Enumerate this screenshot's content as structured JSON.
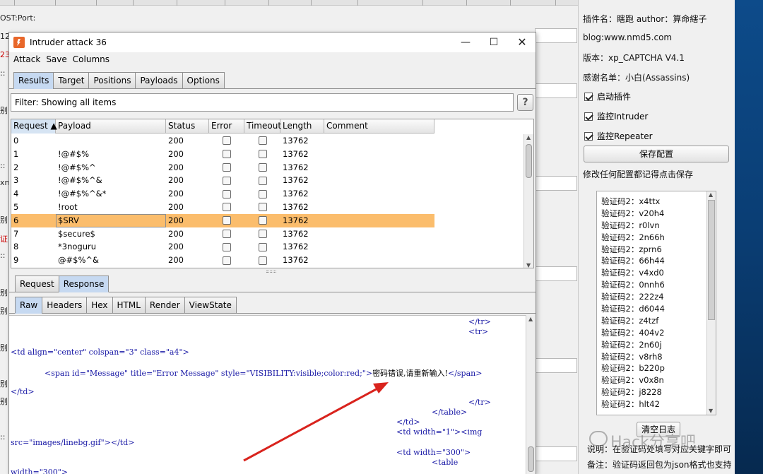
{
  "background_app": {
    "labels": [
      "OST:Port:",
      "12",
      "23",
      "::",
      "别",
      "::",
      "xn",
      "别",
      "证",
      "::",
      "别",
      "别",
      "别",
      "别",
      "别",
      "::"
    ]
  },
  "plugin_panel": {
    "plugin_name": "插件名：瞎跑 author：算命縖子",
    "blog": "blog:www.nmd5.com",
    "version": "版本：xp_CAPTCHA V4.1",
    "thanks": "感谢名单：小白(Assassins)",
    "checkboxes": [
      {
        "label": "启动插件",
        "checked": true
      },
      {
        "label": "监控Intruder",
        "checked": true
      },
      {
        "label": "监控Repeater",
        "checked": true
      }
    ],
    "save_button": "保存配置",
    "save_hint": "修改任何配置都记得点击保存",
    "captcha_log": [
      "验证码2：x4ttx",
      "验证码2：v20h4",
      "验证码2：r0lvn",
      "验证码2：2n66h",
      "验证码2：zprn6",
      "验证码2：66h44",
      "验证码2：v4xd0",
      "验证码2：0nnh6",
      "验证码2：222z4",
      "验证码2：d6044",
      "验证码2：z4tzf",
      "验证码2：404v2",
      "验证码2：2n60j",
      "验证码2：v8rh8",
      "验证码2：b220p",
      "验证码2：v0x8n",
      "验证码2：j8228",
      "验证码2：hlt42"
    ],
    "clear_button": "清空日志",
    "note1": "说明：在验证码处填写对应关键字即可",
    "note2": "备注：验证码返回包为json格式也支持"
  },
  "watermark": "Hack分享吧",
  "window": {
    "title": "Intruder attack 36",
    "menu": [
      "Attack",
      "Save",
      "Columns"
    ],
    "tabs": [
      "Results",
      "Target",
      "Positions",
      "Payloads",
      "Options"
    ],
    "active_tab": "Results",
    "filter": "Filter: Showing all items",
    "help": "?",
    "columns": [
      "Request ▲",
      "Payload",
      "Status",
      "Error",
      "Timeout",
      "Length",
      "Comment"
    ],
    "rows": [
      {
        "request": "0",
        "payload": "",
        "status": "200",
        "length": "13762"
      },
      {
        "request": "1",
        "payload": "!@#$%",
        "status": "200",
        "length": "13762"
      },
      {
        "request": "2",
        "payload": "!@#$%^",
        "status": "200",
        "length": "13762"
      },
      {
        "request": "3",
        "payload": "!@#$%^&",
        "status": "200",
        "length": "13762"
      },
      {
        "request": "4",
        "payload": "!@#$%^&*",
        "status": "200",
        "length": "13762"
      },
      {
        "request": "5",
        "payload": "!root",
        "status": "200",
        "length": "13762"
      },
      {
        "request": "6",
        "payload": "$SRV",
        "status": "200",
        "length": "13762",
        "selected": true
      },
      {
        "request": "7",
        "payload": "$secure$",
        "status": "200",
        "length": "13762"
      },
      {
        "request": "8",
        "payload": "*3noguru",
        "status": "200",
        "length": "13762"
      },
      {
        "request": "9",
        "payload": "@#$%^&",
        "status": "200",
        "length": "13762"
      }
    ],
    "reqresp_tabs": [
      "Request",
      "Response"
    ],
    "active_reqresp": "Response",
    "view_tabs": [
      "Raw",
      "Headers",
      "Hex",
      "HTML",
      "Render",
      "ViewState"
    ],
    "active_view": "Raw",
    "response_lines": [
      "</tr>",
      "<tr>",
      "<td align=\"center\" colspan=\"3\" class=\"a4\">",
      "<span id=\"Message\" title=\"Error Message\" style=\"VISIBILITY:visible;color:red;\">密码错误,请重新输入!</span>",
      "</td>",
      "</tr>",
      "</table>",
      "</td>",
      "<td width=\"1\"><img",
      "src=\"images/linebg.gif\"></td>",
      "<td width=\"300\">",
      "<table",
      "width=\"300\">"
    ]
  },
  "colors": {
    "selected_row": "#fbbd6c",
    "active_tab": "#c6d9f1",
    "arrow": "#d9231d",
    "tag_blue": "#1a1aa6"
  }
}
